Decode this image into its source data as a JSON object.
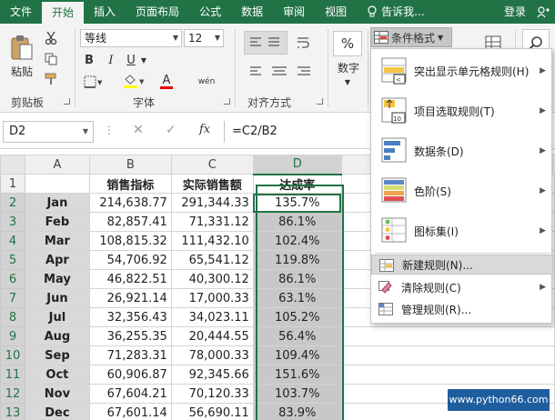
{
  "ribbon_tabs": [
    "文件",
    "开始",
    "插入",
    "页面布局",
    "公式",
    "数据",
    "审阅",
    "视图"
  ],
  "tell_me": "告诉我...",
  "login": "登录",
  "clipboard": {
    "paste": "粘贴",
    "label": "剪贴板"
  },
  "font": {
    "name": "等线",
    "size": "12",
    "bold": "B",
    "italic": "I",
    "underline": "U",
    "font_color_letter": "A",
    "wen": "wén",
    "label": "字体"
  },
  "align": {
    "label": "对齐方式"
  },
  "number": {
    "percent": "%",
    "label": "数字"
  },
  "cond_format_label": "条件格式",
  "name_box": "D2",
  "formula": "=C2/B2",
  "columns": [
    "A",
    "B",
    "C",
    "D"
  ],
  "header_row": {
    "row": "1",
    "a": "",
    "b": "销售指标",
    "c": "实际销售额",
    "d": "达成率"
  },
  "rows": [
    {
      "row": "2",
      "month": "Jan",
      "target": "214,638.77",
      "actual": "291,344.33",
      "rate": "135.7%"
    },
    {
      "row": "3",
      "month": "Feb",
      "target": "82,857.41",
      "actual": "71,331.12",
      "rate": "86.1%"
    },
    {
      "row": "4",
      "month": "Mar",
      "target": "108,815.32",
      "actual": "111,432.10",
      "rate": "102.4%"
    },
    {
      "row": "5",
      "month": "Apr",
      "target": "54,706.92",
      "actual": "65,541.12",
      "rate": "119.8%"
    },
    {
      "row": "6",
      "month": "May",
      "target": "46,822.51",
      "actual": "40,300.12",
      "rate": "86.1%"
    },
    {
      "row": "7",
      "month": "Jun",
      "target": "26,921.14",
      "actual": "17,000.33",
      "rate": "63.1%"
    },
    {
      "row": "8",
      "month": "Jul",
      "target": "32,356.43",
      "actual": "34,023.11",
      "rate": "105.2%"
    },
    {
      "row": "9",
      "month": "Aug",
      "target": "36,255.35",
      "actual": "20,444.55",
      "rate": "56.4%"
    },
    {
      "row": "10",
      "month": "Sep",
      "target": "71,283.31",
      "actual": "78,000.33",
      "rate": "109.4%"
    },
    {
      "row": "11",
      "month": "Oct",
      "target": "60,906.87",
      "actual": "92,345.66",
      "rate": "151.6%"
    },
    {
      "row": "12",
      "month": "Nov",
      "target": "67,604.21",
      "actual": "70,120.33",
      "rate": "103.7%"
    },
    {
      "row": "13",
      "month": "Dec",
      "target": "67,601.14",
      "actual": "56,690.11",
      "rate": "83.9%"
    }
  ],
  "menu": {
    "items_big": [
      {
        "label": "突出显示单元格规则(H)",
        "icon": "highlight-rules-icon"
      },
      {
        "label": "项目选取规则(T)",
        "icon": "top-bottom-rules-icon"
      },
      {
        "label": "数据条(D)",
        "icon": "data-bars-icon"
      },
      {
        "label": "色阶(S)",
        "icon": "color-scales-icon"
      },
      {
        "label": "图标集(I)",
        "icon": "icon-sets-icon"
      }
    ],
    "items_small": [
      {
        "label": "新建规则(N)...",
        "icon": "new-rule-icon"
      },
      {
        "label": "清除规则(C)",
        "icon": "clear-rules-icon"
      },
      {
        "label": "管理规则(R)...",
        "icon": "manage-rules-icon"
      }
    ]
  },
  "watermark": "www.python66.com",
  "colors": {
    "excel_green": "#217346",
    "selection_fill": "#c8c8c8",
    "month_fill": "#d9d9d9"
  }
}
